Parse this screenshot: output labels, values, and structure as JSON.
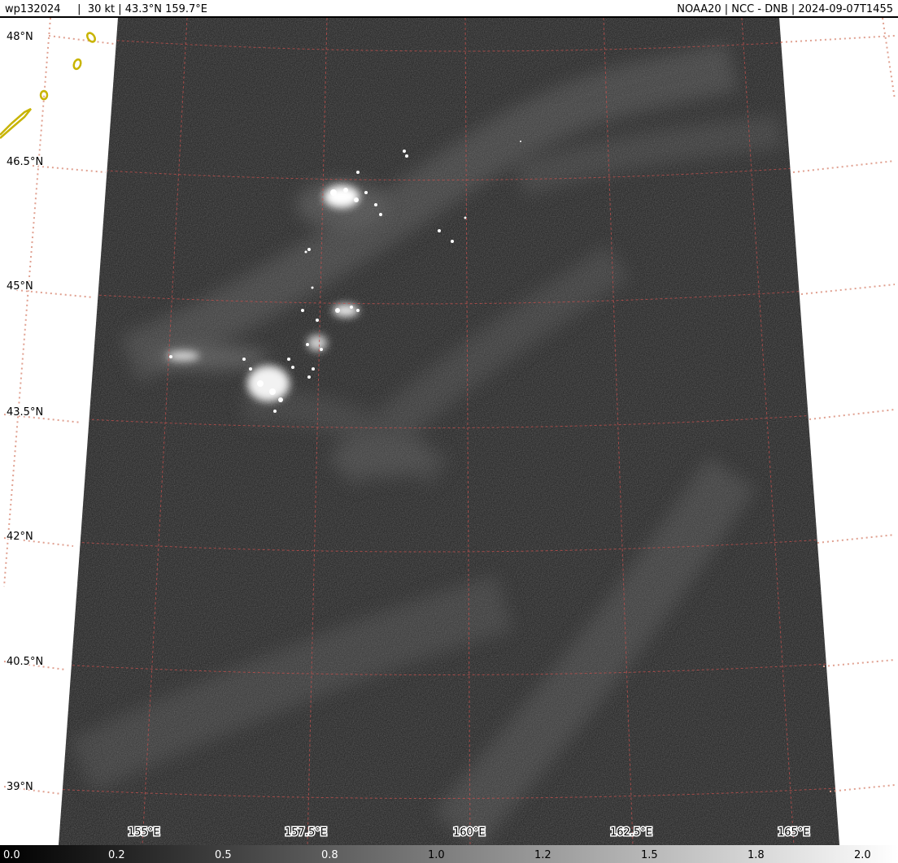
{
  "header": {
    "left": "wp132024     |  30 kt | 43.3°N 159.7°E",
    "right": "NOAA20 | NCC - DNB | 2024-09-07T1455"
  },
  "lat_labels": [
    "48°N",
    "46.5°N",
    "45°N",
    "43.5°N",
    "42°N",
    "40.5°N",
    "39°N"
  ],
  "lon_labels": [
    "155°E",
    "157.5°E",
    "160°E",
    "162.5°E",
    "165°E"
  ],
  "colorbar": {
    "ticks": [
      "0.0",
      "0.2",
      "0.5",
      "0.8",
      "1.0",
      "1.2",
      "1.5",
      "1.8",
      "2.0"
    ]
  },
  "colors": {
    "grid": "#c0504d",
    "coast": "#c8b400",
    "background": "#ffffff"
  }
}
